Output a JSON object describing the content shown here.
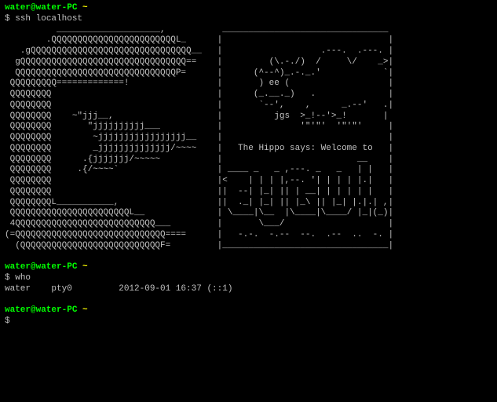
{
  "prompt1": {
    "userhost": "water@water-PC",
    "path": "~",
    "symbol": "$",
    "command": "ssh localhost"
  },
  "motd": "          ____________________,           ________________________________\n        .QQQQQQQQQQQQQQQQQQQQQQQQL_      |                                |\n   .gQQQQQQQQQQQQQQQQQQQQQQQQQQQQQQQ__   |                   .---.  .---. |\n  gQQQQQQQQQQQQQQQQQQQQQQQQQQQQQQQQ==    |         (\\.-./)  /     \\/    _>|\n  QQQQQQQQQQQQQQQQQQQQQQQQQQQQQQQP=      |      (^--^)_.-._.'            `|\n QQQQQQQQQ=============!                 |       ) ee (                   |\n QQQQQQQQ                                |      (_.__._)   .              |\n QQQQQQQQ                                |       `--',    ,      _.--'   .|\n QQQQQQQQ    ~\"jjj__,                    |          jgs  >_!--'>_!       |\n QQQQQQQQ       \"jjjjjjjjjj___           |               '\"'\"'  '\"'\"'     |\n QQQQQQQQ        ~jjjjjjjjjjjjjjjjj__    |                                |\n QQQQQQQQ        _jjjjjjjjjjjjjj/~~~~    |   The Hippo says: Welcome to   |\n QQQQQQQQ      .{jjjjjjj/~~~~~           |                          __    |\n QQQQQQQQ     .{/~~~~`                   | ____ _   _ ,---. _   _   | |   |\n QQQQQQQQ                                |<    | | | |,--. '| | | | |.|   |\n QQQQQQQQ                                ||  --| |_| || | __| | | | | |   |\n QQQQQQQQL___________,                   ||  ._| |_| || |_\\ || |_| |.|.| ,|\n QQQQQQQQQQQQQQQQQQQQQQQL__              | \\____|\\__  |\\____|\\____/ |_|(_)|\n 4QQQQQQQQQQQQQQQQQQQQQQQQQQQ___         |       \\___/                    |\n(=QQQQQQQQQQQQQQQQQQQQQQQQQQQQQ====      |   -.-.  -.--  --.  .--  ..  -. |\n  (QQQQQQQQQQQQQQQQQQQQQQQQQQQF=         |________________________________|",
  "prompt2": {
    "userhost": "water@water-PC",
    "path": "~",
    "symbol": "$",
    "command": "who"
  },
  "who_output": "water    pty0         2012-09-01 16:37 (::1)",
  "prompt3": {
    "userhost": "water@water-PC",
    "path": "~",
    "symbol": "$",
    "command": ""
  }
}
